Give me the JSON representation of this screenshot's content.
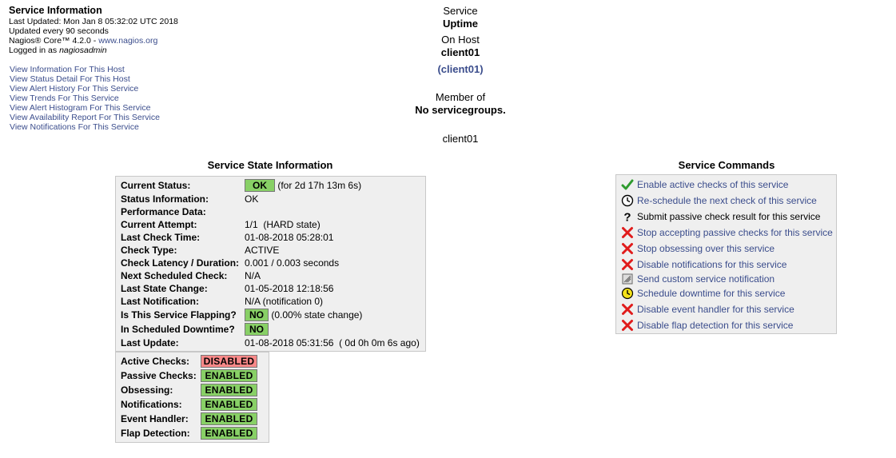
{
  "info": {
    "title": "Service Information",
    "last_updated": "Last Updated: Mon Jan 8 05:32:02 UTC 2018",
    "update_interval": "Updated every 90 seconds",
    "product_prefix": "Nagios® Core™ 4.2.0 - ",
    "product_link": "www.nagios.org",
    "logged_prefix": "Logged in as ",
    "logged_user": "nagiosadmin"
  },
  "nav_links": [
    "View Information For This Host",
    "View Status Detail For This Host",
    "View Alert History For This Service",
    "View Trends For This Service",
    "View Alert Histogram For This Service",
    "View Availability Report For This Service",
    "View Notifications For This Service"
  ],
  "center": {
    "service_label": "Service",
    "service_name": "Uptime",
    "host_label": "On Host",
    "host_name": "client01",
    "host_alias": "(client01)",
    "member_label": "Member of",
    "member_value": "No servicegroups.",
    "host_address": "client01"
  },
  "state_info": {
    "title": "Service State Information",
    "rows": [
      {
        "label": "Current Status:",
        "badge": "OK",
        "value": "(for 2d 17h 13m 6s)"
      },
      {
        "label": "Status Information:",
        "value": "OK"
      },
      {
        "label": "Performance Data:",
        "value": ""
      },
      {
        "label": "Current Attempt:",
        "value": "1/1  (HARD state)"
      },
      {
        "label": "Last Check Time:",
        "value": "01-08-2018 05:28:01"
      },
      {
        "label": "Check Type:",
        "value": "ACTIVE"
      },
      {
        "label": "Check Latency / Duration:",
        "value": "0.001 / 0.003 seconds"
      },
      {
        "label": "Next Scheduled Check:",
        "value": "N/A"
      },
      {
        "label": "Last State Change:",
        "value": "01-05-2018 12:18:56"
      },
      {
        "label": "Last Notification:",
        "value": "N/A (notification 0)"
      },
      {
        "label": "Is This Service Flapping?",
        "badge": "NO",
        "value": "(0.00% state change)"
      },
      {
        "label": "In Scheduled Downtime?",
        "badge": "NO",
        "value": ""
      },
      {
        "label": "Last Update:",
        "value": "01-08-2018 05:31:56  ( 0d 0h 0m 6s ago)"
      }
    ]
  },
  "features": [
    {
      "label": "Active Checks:",
      "value": "DISABLED",
      "status": "bad"
    },
    {
      "label": "Passive Checks:",
      "value": "ENABLED",
      "status": "ok"
    },
    {
      "label": "Obsessing:",
      "value": "ENABLED",
      "status": "ok"
    },
    {
      "label": "Notifications:",
      "value": "ENABLED",
      "status": "ok"
    },
    {
      "label": "Event Handler:",
      "value": "ENABLED",
      "status": "ok"
    },
    {
      "label": "Flap Detection:",
      "value": "ENABLED",
      "status": "ok"
    }
  ],
  "commands": {
    "title": "Service Commands",
    "items": [
      {
        "icon": "check-icon",
        "label": "Enable active checks of this service"
      },
      {
        "icon": "clock-icon",
        "label": "Re-schedule the next check of this service"
      },
      {
        "icon": "question-icon",
        "label": "Submit passive check result for this service"
      },
      {
        "icon": "x-icon",
        "label": "Stop accepting passive checks for this service"
      },
      {
        "icon": "x-icon",
        "label": "Stop obsessing over this service"
      },
      {
        "icon": "x-icon",
        "label": "Disable notifications for this service"
      },
      {
        "icon": "notify-icon",
        "label": "Send custom service notification"
      },
      {
        "icon": "downtime-clock-icon",
        "label": "Schedule downtime for this service"
      },
      {
        "icon": "x-icon",
        "label": "Disable event handler for this service"
      },
      {
        "icon": "x-icon",
        "label": "Disable flap detection for this service"
      }
    ]
  },
  "colors": {
    "link": "#3b4d8c",
    "ok_badge": "#88d066",
    "bad_badge": "#f88888",
    "panel_bg": "#efefef"
  }
}
